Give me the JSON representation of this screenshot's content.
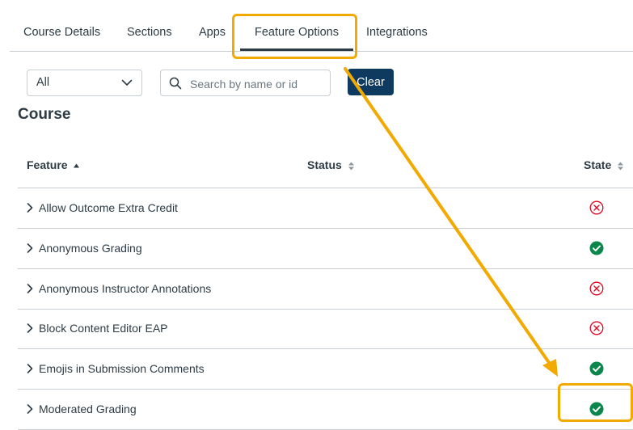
{
  "tabs": [
    {
      "label": "Course Details",
      "active": false
    },
    {
      "label": "Sections",
      "active": false
    },
    {
      "label": "Apps",
      "active": false
    },
    {
      "label": "Feature Options",
      "active": true
    },
    {
      "label": "Integrations",
      "active": false
    }
  ],
  "filter": {
    "selected": "All"
  },
  "search": {
    "placeholder": "Search by name or id",
    "value": ""
  },
  "clear_label": "Clear",
  "section_title": "Course",
  "table": {
    "columns": [
      "Feature",
      "Status",
      "State"
    ],
    "rows": [
      {
        "feature": "Allow Outcome Extra Credit",
        "state": "off"
      },
      {
        "feature": "Anonymous Grading",
        "state": "on"
      },
      {
        "feature": "Anonymous Instructor Annotations",
        "state": "off"
      },
      {
        "feature": "Block Content Editor EAP",
        "state": "off"
      },
      {
        "feature": "Emojis in Submission Comments",
        "state": "on"
      },
      {
        "feature": "Moderated Grading",
        "state": "on"
      }
    ]
  },
  "colors": {
    "annotation": "#f2a900",
    "state_on": "#0b874b",
    "state_off": "#e0061f",
    "button": "#0f3a5f",
    "text": "#2d3b45"
  },
  "icons": {
    "expand": "chevron-right-icon",
    "state_on": "check-circle-icon",
    "state_off": "x-circle-icon",
    "sort": "sort-icon",
    "search": "search-icon",
    "dropdown": "chevron-down-icon"
  }
}
